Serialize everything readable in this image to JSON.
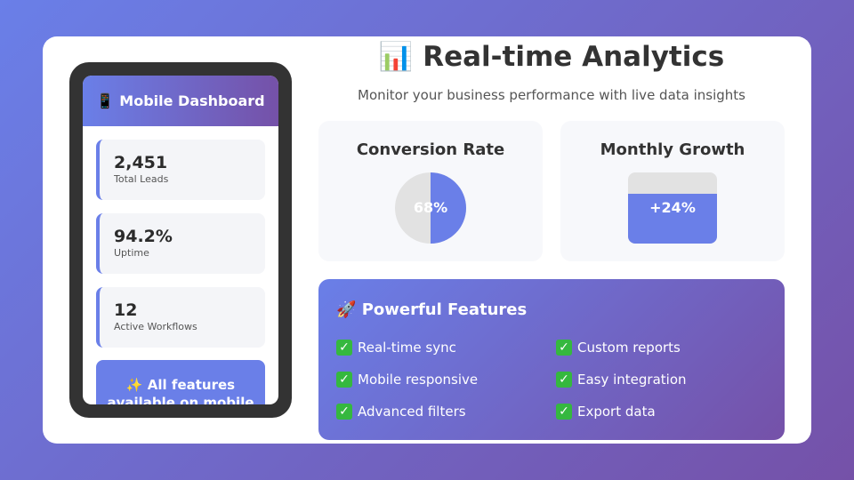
{
  "phone": {
    "header_icon": "📱",
    "header_title": "Mobile Dashboard",
    "stats": [
      {
        "value": "2,451",
        "label": "Total Leads"
      },
      {
        "value": "94.2%",
        "label": "Uptime"
      },
      {
        "value": "12",
        "label": "Active Workflows"
      }
    ],
    "banner": "✨ All features available on mobile"
  },
  "header": {
    "icon": "📊",
    "title": "Real-time Analytics",
    "subtitle": "Monitor your business performance with live data insights"
  },
  "metrics": {
    "conversion": {
      "title": "Conversion Rate",
      "label": "68%",
      "fraction": 0.5
    },
    "growth": {
      "title": "Monthly Growth",
      "label": "+24%",
      "fraction": 0.7
    }
  },
  "features": {
    "icon": "🚀",
    "title": "Powerful Features",
    "items": [
      "Real-time sync",
      "Custom reports",
      "Mobile responsive",
      "Easy integration",
      "Advanced filters",
      "Export data"
    ]
  },
  "colors": {
    "accent": "#6a7fe8",
    "accent_dark": "#7551a8",
    "check": "#35b83f"
  }
}
